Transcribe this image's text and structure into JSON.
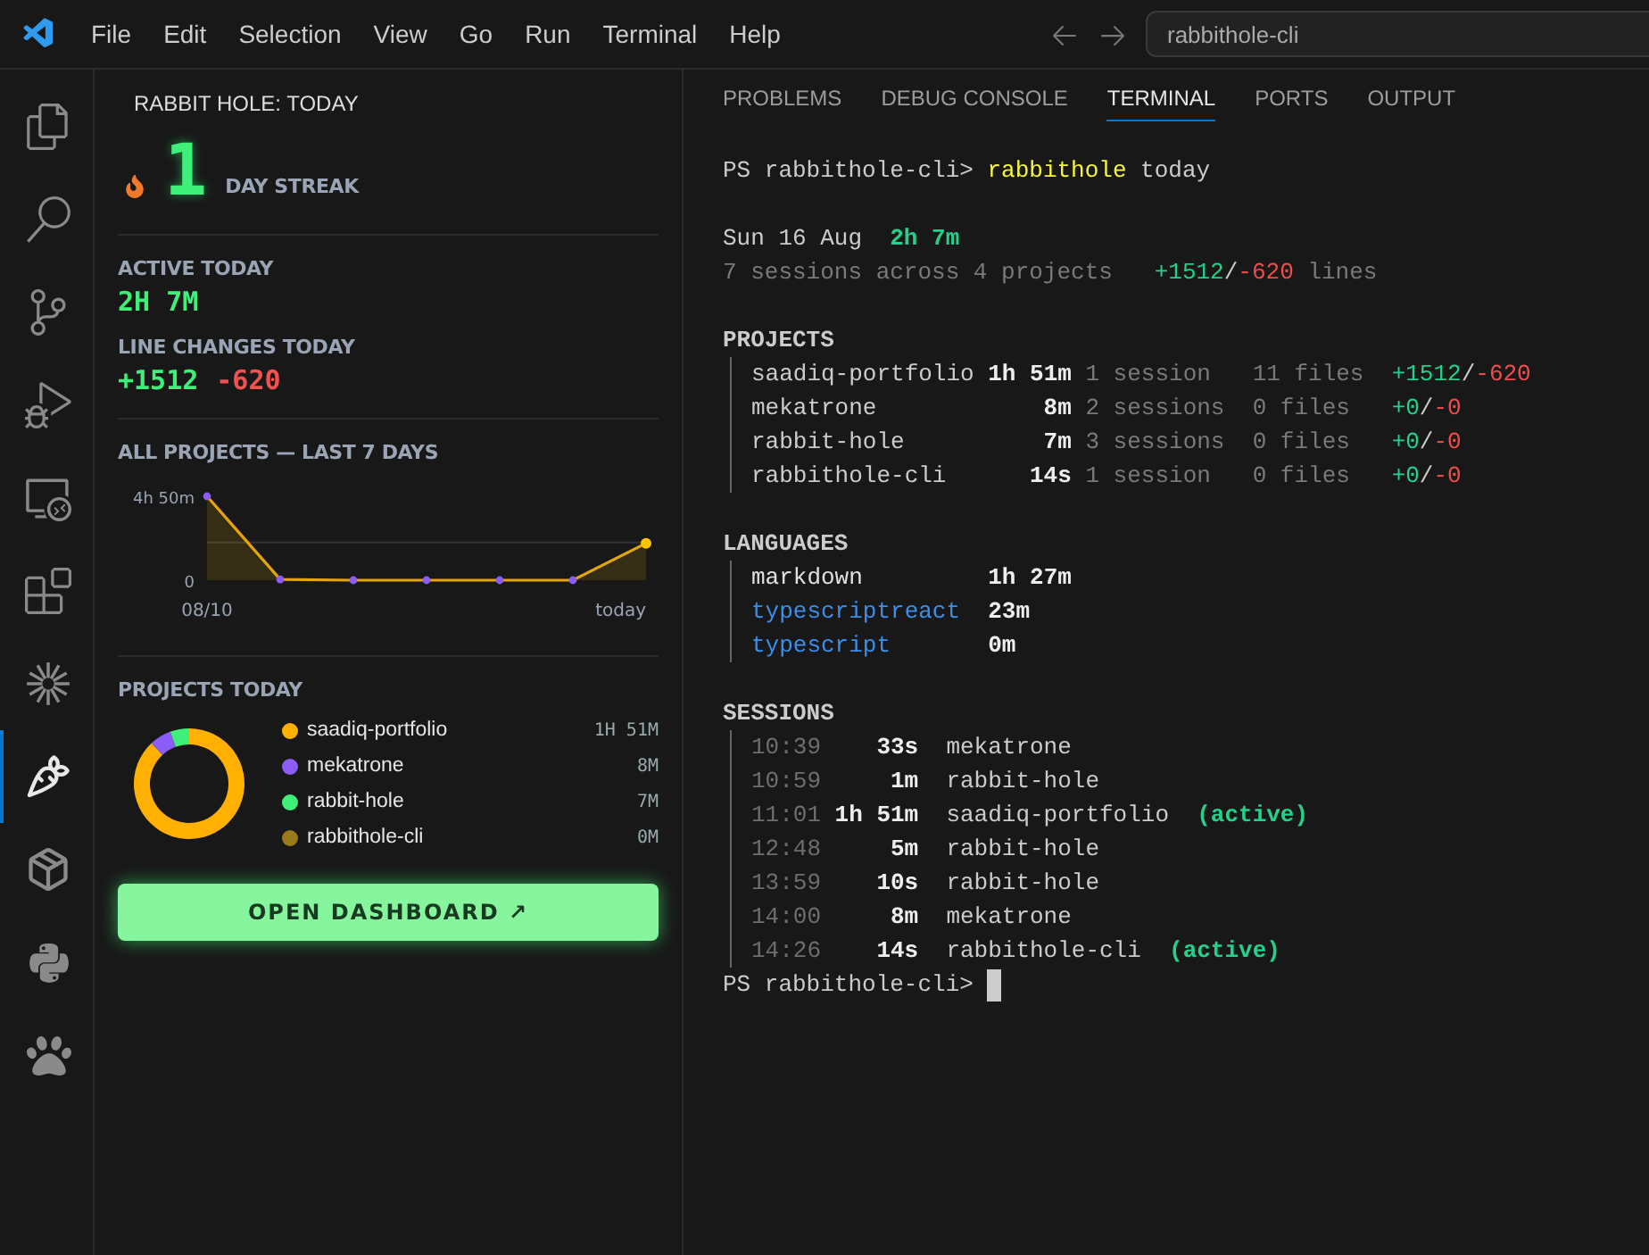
{
  "menu_bar": {
    "items": [
      "File",
      "Edit",
      "Selection",
      "View",
      "Go",
      "Run",
      "Terminal",
      "Help"
    ],
    "search": {
      "value": "rabbithole-cli"
    }
  },
  "activity_bar": [
    {
      "selected": false
    },
    {
      "selected": false
    },
    {
      "selected": false
    },
    {
      "selected": false
    },
    {
      "selected": false
    },
    {
      "selected": false
    },
    {
      "selected": false
    },
    {
      "selected": true
    },
    {
      "selected": false
    },
    {
      "selected": false
    },
    {
      "selected": false
    }
  ],
  "sidebar": {
    "title": "RABBIT HOLE: TODAY",
    "streak": {
      "count": "1",
      "label": "DAY STREAK"
    },
    "active_today": {
      "label": "ACTIVE TODAY",
      "value": "2H 7M"
    },
    "line_changes": {
      "label": "LINE CHANGES TODAY",
      "added": "+1512",
      "removed": "-620"
    },
    "weekly": {
      "heading": "ALL PROJECTS — LAST 7 DAYS",
      "y_labels": [
        "4h 50m",
        "0"
      ],
      "x_labels": [
        "08/10",
        "today"
      ]
    },
    "projects_today": {
      "heading": "PROJECTS TODAY",
      "chart_data": {
        "type": "donut",
        "categories": [
          "saadiq-portfolio",
          "mekatrone",
          "rabbit-hole",
          "rabbithole-cli"
        ],
        "values": [
          88.1,
          6.3,
          5.6,
          0
        ]
      },
      "items": [
        {
          "time": "1H 51M",
          "color": "#ffb000"
        },
        {
          "time": "8M",
          "color": "#8b5cf6"
        },
        {
          "time": "7M",
          "color": "#3ef07a"
        },
        {
          "time": "0M",
          "color": "#9a7a1c"
        }
      ]
    },
    "button": "OPEN DASHBOARD ↗"
  },
  "panel": {
    "tabs": [
      {
        "label": "PROBLEMS",
        "selected": false
      },
      {
        "label": "DEBUG CONSOLE",
        "selected": false
      },
      {
        "label": "TERMINAL",
        "selected": true
      },
      {
        "label": "PORTS",
        "selected": false
      },
      {
        "label": "OUTPUT",
        "selected": false
      }
    ],
    "terminal": {
      "prompt": "PS rabbithole-cli>",
      "command": "rabbithole",
      "argument": "today",
      "date": "Sun 16 Aug",
      "total": "2h 7m",
      "summary": "7 sessions across 4 projects",
      "added": "+1512",
      "slash": "/",
      "removed": "-620",
      "lines_label": "lines",
      "projects_heading": "PROJECTS",
      "projects": [
        {
          "name": "saadiq-portfolio",
          "time": "1h 51m",
          "sessions": "1 session",
          "files": "11 files",
          "added": "+1512",
          "slash": "/",
          "removed": "-620"
        },
        {
          "name": "mekatrone",
          "time": "8m",
          "sessions": "2 sessions",
          "files": "0 files",
          "added": "+0",
          "slash": "/",
          "removed": "-0"
        },
        {
          "name": "rabbit-hole",
          "time": "7m",
          "sessions": "3 sessions",
          "files": "0 files",
          "added": "+0",
          "slash": "/",
          "removed": "-0"
        },
        {
          "name": "rabbithole-cli",
          "time": "14s",
          "sessions": "1 session",
          "files": "0 files",
          "added": "+0",
          "slash": "/",
          "removed": "-0"
        }
      ],
      "languages_heading": "LANGUAGES",
      "languages": [
        {
          "name": "markdown",
          "time": "1h 27m",
          "color": "#e0e0e0"
        },
        {
          "name": "typescriptreact",
          "time": "23m",
          "color": "#3b8eea"
        },
        {
          "name": "typescript",
          "time": "0m",
          "color": "#3b8eea"
        }
      ],
      "sessions_heading": "SESSIONS",
      "sessions": [
        {
          "start": "10:39",
          "duration": "33s",
          "project": "mekatrone"
        },
        {
          "start": "10:59",
          "duration": "1m",
          "project": "rabbit-hole"
        },
        {
          "start": "11:01",
          "duration": "1h 51m",
          "project": "saadiq-portfolio",
          "tag": "(active)"
        },
        {
          "start": "12:48",
          "duration": "5m",
          "project": "rabbit-hole"
        },
        {
          "start": "13:59",
          "duration": "10s",
          "project": "rabbit-hole"
        },
        {
          "start": "14:00",
          "duration": "8m",
          "project": "mekatrone"
        },
        {
          "start": "14:26",
          "duration": "14s",
          "project": "rabbithole-cli",
          "tag": "(active)"
        }
      ],
      "final_prompt": "PS rabbithole-cli>"
    }
  }
}
